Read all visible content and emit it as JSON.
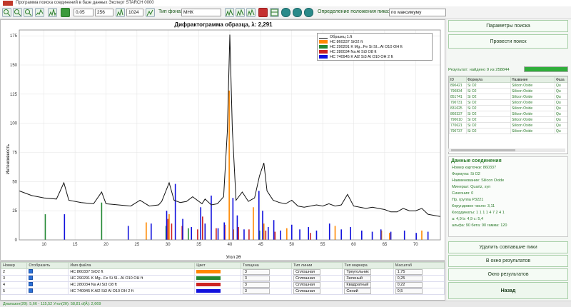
{
  "window": {
    "title": "Программа поиска соединений в базе данных Эксперт STARCH 0000"
  },
  "toolbar": {
    "field1": "0,05",
    "field2": "256",
    "field3": "1024",
    "bg_type_label": "Тип фона:",
    "bg_type_value": "МНК",
    "peak_mode_label": "Определение положения пика:",
    "peak_mode_value": "по максимуму"
  },
  "chart": {
    "title": "Дифрактограмма образца, λ: 2,291",
    "ylabel": "Интенсивность",
    "xlabel": "Угол 2θ"
  },
  "chart_data": {
    "type": "line",
    "title": "Дифрактограмма образца, λ: 2,291",
    "xlabel": "Угол 2θ",
    "ylabel": "Интенсивность",
    "xlim": [
      6,
      74
    ],
    "ylim": [
      0,
      180
    ],
    "xticks": [
      10,
      15,
      20,
      25,
      30,
      35,
      40,
      45,
      50,
      55,
      60,
      65,
      70
    ],
    "yticks": [
      0,
      25,
      50,
      75,
      100,
      125,
      150,
      175
    ],
    "series": [
      {
        "name": "Образец 1.ft",
        "color": "#111111",
        "x": [
          6,
          8,
          10,
          12,
          13.2,
          14,
          16,
          18,
          19.3,
          20,
          22,
          24,
          25.5,
          27,
          28.5,
          29,
          30.2,
          31,
          32,
          33,
          34,
          35.5,
          36,
          37,
          38,
          39,
          39.6,
          40,
          40.4,
          41,
          42,
          43,
          44,
          44.8,
          45.5,
          46,
          47,
          48,
          49,
          50,
          51,
          52,
          53,
          54,
          55,
          56,
          57,
          58,
          59,
          60,
          61,
          62,
          63,
          64,
          65,
          66,
          67,
          68,
          69,
          70,
          71,
          72,
          73,
          74
        ],
        "y": [
          42,
          38,
          36,
          35,
          49,
          34,
          32,
          31,
          41,
          31,
          30,
          29,
          34,
          29,
          30,
          33,
          49,
          34,
          32,
          33,
          37,
          31,
          35,
          30,
          31,
          37,
          93,
          176,
          95,
          34,
          41,
          33,
          36,
          55,
          66,
          42,
          34,
          32,
          31,
          34,
          29,
          28,
          29,
          30,
          29,
          31,
          29,
          30,
          39,
          29,
          28,
          27,
          28,
          27,
          26,
          24,
          24,
          27,
          25,
          25,
          27,
          22,
          21,
          20
        ]
      },
      {
        "name": "НС 860337 SiO2 ft",
        "color": "#ff8800",
        "x": [
          26.5,
          30.2,
          36.0,
          39.9,
          40.6,
          43.8,
          45.5,
          49.2,
          57.0,
          64.5,
          65.8,
          71.0
        ],
        "y": [
          15,
          22,
          12,
          128,
          9,
          28,
          14,
          10,
          12,
          8,
          6,
          8
        ]
      },
      {
        "name": "НС 290291 K Mg...Fe Si Sl...Al O10 OH ft",
        "color": "#228833",
        "x": [
          10.2,
          19.3,
          29.7,
          33.3,
          44.8
        ],
        "y": [
          22,
          32,
          12,
          10,
          8
        ]
      },
      {
        "name": "НС 280034 Na Al Si3 O8 ft",
        "color": "#cc2222",
        "x": [
          30.0,
          30.6,
          32.3,
          34.8,
          35.6,
          37.8,
          39.2,
          41.4,
          43.1,
          45.8,
          47.3,
          53.0
        ],
        "y": [
          18,
          14,
          12,
          9,
          20,
          10,
          13,
          11,
          9,
          8,
          7,
          6
        ]
      },
      {
        "name": "НС 740945 K Al2 Si3 Al O10 OH 2 ft",
        "color": "#1111dd",
        "x": [
          13.3,
          23.6,
          27.3,
          29.8,
          31.2,
          32.4,
          33.8,
          35.3,
          36.0,
          37.0,
          38.1,
          39.1,
          40.5,
          41.2,
          42.3,
          44.7,
          45.3,
          46.2,
          47.1,
          48.2,
          50.0,
          51.3,
          52.7,
          54.0,
          56.1,
          58.0,
          59.5,
          61.3,
          63.0,
          64.4,
          66.0,
          68.2,
          70.1,
          72.0
        ],
        "y": [
          22,
          12,
          14,
          25,
          48,
          18,
          11,
          28,
          14,
          38,
          10,
          15,
          36,
          21,
          9,
          42,
          25,
          11,
          17,
          8,
          13,
          9,
          11,
          8,
          14,
          9,
          11,
          8,
          7,
          9,
          7,
          8,
          6,
          7
        ]
      }
    ],
    "grid": true,
    "legend": "top-right"
  },
  "phase_table": {
    "headers": [
      "Номер",
      "Отобразить",
      "Имя файла",
      "Цвет",
      "Толщина",
      "Тип линии",
      "Тип маркера",
      "Масштаб"
    ],
    "rows": [
      {
        "num": "2",
        "name": "НС 860337 SiO2 ft",
        "color": "#ff8800",
        "thick": "3",
        "line": "Сплошная",
        "marker": "Треугольник",
        "scale": "1,75"
      },
      {
        "num": "3",
        "name": "НС 290291 K Mg...Fe Si Sl...Al O10 OH ft",
        "color": "#228833",
        "thick": "3",
        "line": "Сплошная",
        "marker": "Зеленый",
        "scale": "0,25"
      },
      {
        "num": "4",
        "name": "НС 280034 Na Al Si3 O8 ft",
        "color": "#cc2222",
        "thick": "3",
        "line": "Сплошная",
        "marker": "Квадратный",
        "scale": "0,22"
      },
      {
        "num": "5",
        "name": "НС 740945 K Al2 Si3 Al O10 OH 2 ft",
        "color": "#1111dd",
        "thick": "3",
        "line": "Сплошная",
        "marker": "Синий",
        "scale": "0,5"
      }
    ]
  },
  "right": {
    "search_params": "Параметры поиска",
    "run_search": "Провести поиск",
    "result_text": "Результат: найдено 9 из 258844",
    "progress": 1.0,
    "res_headers": [
      "ID",
      "Формула",
      "Название",
      "Фаза"
    ],
    "res_rows": [
      [
        "890421",
        "Si O2",
        "Silicon Oxide",
        "Qu"
      ],
      [
        "790834",
        "Si O2",
        "Silicon Oxide",
        "Qu"
      ],
      [
        "851741",
        "Si O2",
        "Silicon Oxide",
        "Qu"
      ],
      [
        "790731",
        "Si O2",
        "Silicon Oxide",
        "Qu"
      ],
      [
        "831625",
        "Si O2",
        "Silicon Oxide",
        "Qu"
      ],
      [
        "860337",
        "Si O2",
        "Silicon Oxide",
        "Qu"
      ],
      [
        "790610",
        "Si O2",
        "Silicon Oxide",
        "Qu"
      ],
      [
        "770621",
        "Si O2",
        "Silicon Oxide",
        "Qu"
      ],
      [
        "790737",
        "Si O2",
        "Silicon Oxide",
        "Qu"
      ]
    ],
    "compound_title": "Данные соединения",
    "compound_lines": [
      "Номер карточки: 860337",
      "Формула: Si O2",
      "Наименование: Silicon Oxide",
      "Минерал: Quartz, syn",
      "Сингония: 0",
      "Пр. группа P3221",
      "Корундовое число: 3,11",
      "Координаты: 1 1 1 1 4 7 2 4 1",
      "a: 4,9  b: 4,9  c: 5,4",
      "альфа: 90 бета: 90 гамма: 120"
    ],
    "delete_peaks": "Удалить совпавшие пики",
    "to_results": "В окно результатов",
    "results_window": "Окно результатов",
    "back": "Назад"
  },
  "status": {
    "text": "Диапазон(2θ): 5,66 - 115,52   Угол(2θ): 58,81   d(Å): 2,669"
  }
}
